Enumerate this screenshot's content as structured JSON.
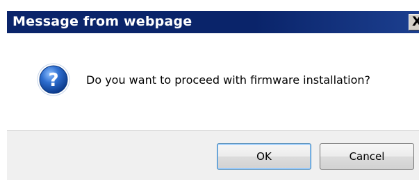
{
  "window": {
    "title": "Message from webpage",
    "close_glyph": "X"
  },
  "dialog": {
    "icon": "question-icon",
    "message": "Do you want to proceed with firmware installation?"
  },
  "buttons": {
    "ok_label": "OK",
    "cancel_label": "Cancel"
  },
  "colors": {
    "titlebar": "#0a246a",
    "title_text": "#ffffff",
    "content_bg": "#ffffff",
    "button_bar_bg": "#f0f0f0",
    "icon_blue": "#1e5bb8"
  }
}
